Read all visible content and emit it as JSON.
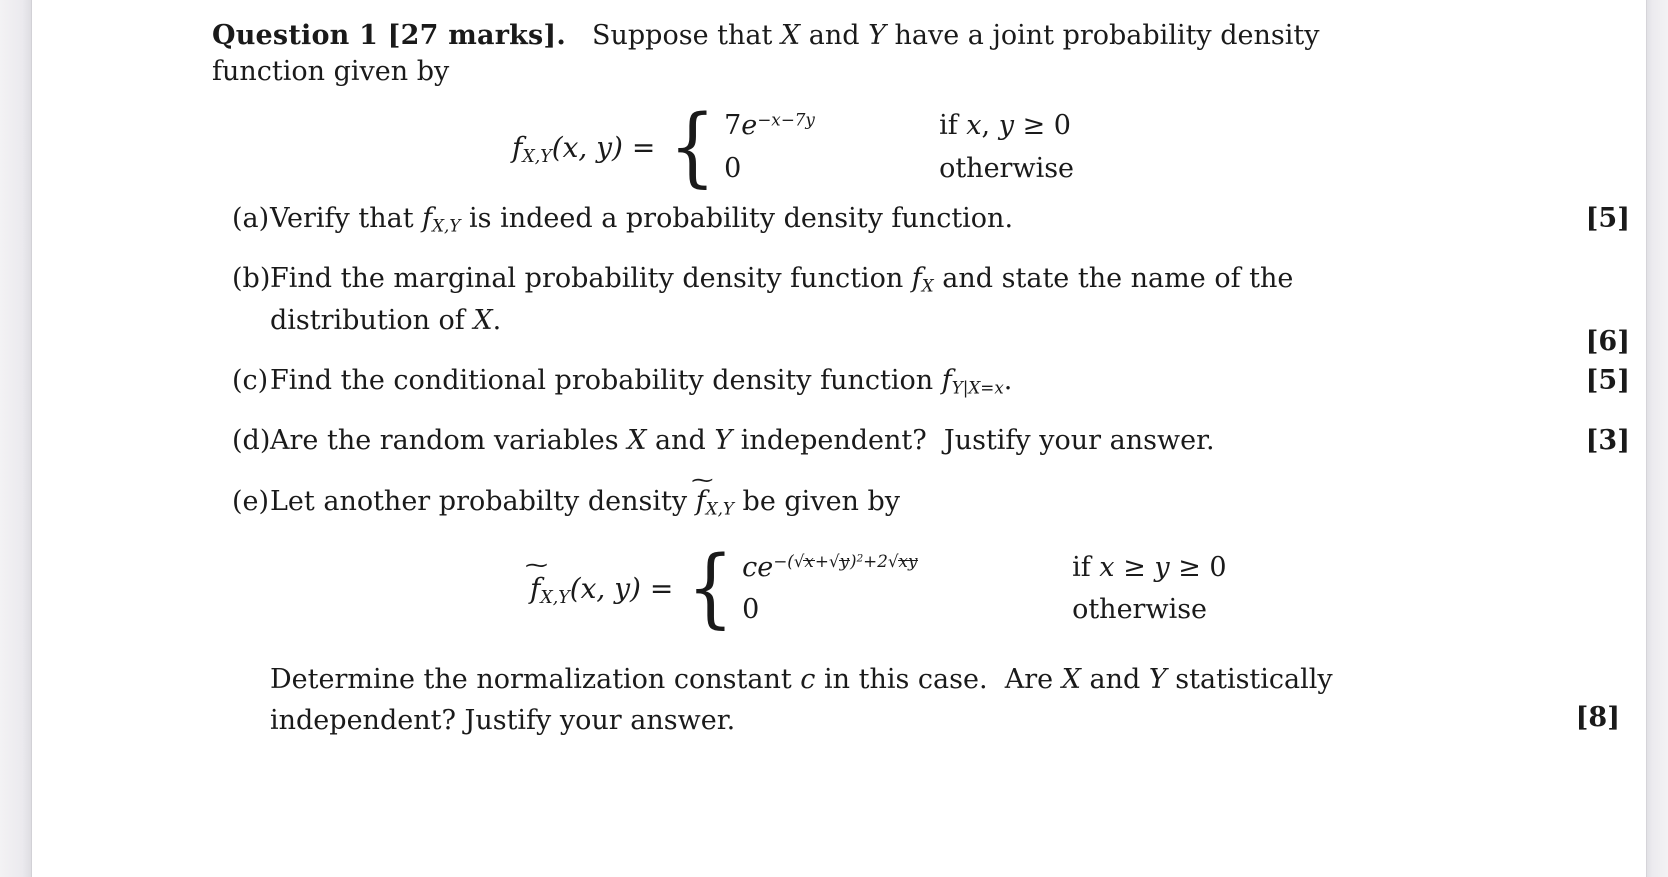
{
  "document": {
    "question": {
      "heading_bold": "Question 1 [27 marks].",
      "intro_line1": "Suppose that X and Y have a joint probability density",
      "intro_line2": "function given by"
    },
    "equation_1": {
      "lhs": "f",
      "lhs_sub": "X,Y",
      "lhs_args": "(x, y)",
      "equals": "=",
      "case_1_value_coef": "7e",
      "case_1_value_exp": "−x−7y",
      "case_1_condition": "if x, y ≥ 0",
      "case_2_value": "0",
      "case_2_condition": "otherwise"
    },
    "parts": [
      {
        "label": "(a)",
        "text_before": "Verify that ",
        "math_f": "f",
        "math_sub": "X,Y",
        "text_after": " is indeed a probability density function.",
        "marks": "[5]"
      },
      {
        "label": "(b)",
        "line1_before": "Find the marginal probability density function ",
        "line1_f": "f",
        "line1_sub": "X",
        "line1_after": " and state the name of the",
        "line2_before": "distribution of ",
        "line2_var": "X",
        "line2_after": ".",
        "marks": "[6]"
      },
      {
        "label": "(c)",
        "text_before": "Find the conditional probability density function ",
        "math_f": "f",
        "math_sub": "Y|X=x",
        "text_after": ".",
        "marks": "[5]"
      },
      {
        "label": "(d)",
        "text": "Are the random variables X and Y independent? Justify your answer.",
        "marks": "[3]"
      },
      {
        "label": "(e)",
        "intro_before": "Let another probabilty density ",
        "intro_f": "f",
        "intro_sub": "X,Y",
        "intro_after": " be given by",
        "marks": "[8]"
      }
    ],
    "equation_2": {
      "lhs": "f",
      "lhs_sub": "X,Y",
      "lhs_args": "(x, y)",
      "equals": "=",
      "case_1_coef": "ce",
      "case_1_exp": "−(√x+√y)²+2√xy",
      "case_1_condition": "if x ≥ y ≥ 0",
      "case_2_value": "0",
      "case_2_condition": "otherwise"
    },
    "tail": {
      "line1": "Determine the normalization constant c in this case. Are X and Y statistically",
      "line2": "independent? Justify your answer.",
      "marks": "[8]"
    }
  },
  "colors": {
    "page_background": "#ffffff",
    "gutter": "#ebeaee",
    "text": "#1a1a1a"
  }
}
